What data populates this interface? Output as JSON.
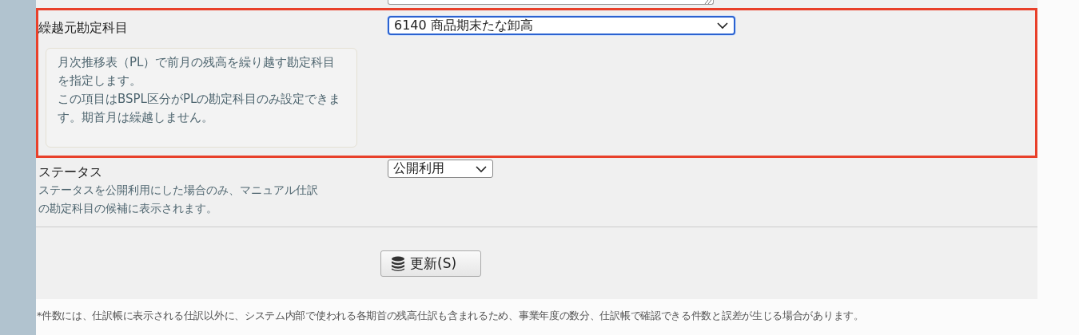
{
  "carryover_account": {
    "label": "繰越元勘定科目",
    "highlighted": true,
    "help": [
      "月次推移表（PL）で前月の残高を繰り越す勘定科目を指定します。",
      "この項目はBSPL区分がPLの勘定科目のみ設定できます。期首月は繰越しません。"
    ],
    "select": {
      "value": "6140 商品期末たな卸高",
      "focused": true
    }
  },
  "status": {
    "label": "ステータス",
    "description": "ステータスを公開利用にした場合のみ、マニュアル仕訳の勘定科目の候補に表示されます。",
    "select": {
      "value": "公開利用"
    }
  },
  "update_button": {
    "label": "更新(S)"
  },
  "footnote": "*件数には、仕訳帳に表示される仕訳以外に、システム内部で使われる各期首の残高仕訳も含まれるため、事業年度の数分、仕訳帳で確認できる件数と誤差が生じる場合があります。"
}
